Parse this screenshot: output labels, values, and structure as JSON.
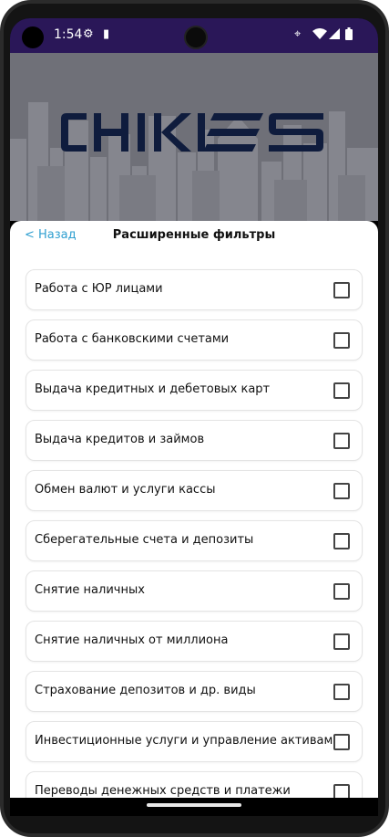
{
  "status": {
    "time": "1:54"
  },
  "header": {
    "logo_text": "CHIKIES",
    "back_label": "< Назад",
    "title": "Расширенные фильтры"
  },
  "filters": [
    {
      "label": "Работа с ЮР лицами",
      "checked": false
    },
    {
      "label": "Работа с банковскими счетами",
      "checked": false
    },
    {
      "label": "Выдача кредитных и дебетовых карт",
      "checked": false
    },
    {
      "label": "Выдача кредитов и займов",
      "checked": false
    },
    {
      "label": "Обмен валют и услуги кассы",
      "checked": false
    },
    {
      "label": "Сберегательные счета и депозиты",
      "checked": false
    },
    {
      "label": "Снятие наличных",
      "checked": false
    },
    {
      "label": "Снятие наличных от миллиона",
      "checked": false
    },
    {
      "label": "Страхование депозитов и др. виды",
      "checked": false
    },
    {
      "label": "Инвестиционные услуги и управление активами",
      "checked": false
    },
    {
      "label": "Переводы денежных средств и платежи",
      "checked": false
    }
  ],
  "colors": {
    "status_bar": "#2a1758",
    "accent_link": "#2f9fd0",
    "logo_navy": "#0f1c3d"
  }
}
